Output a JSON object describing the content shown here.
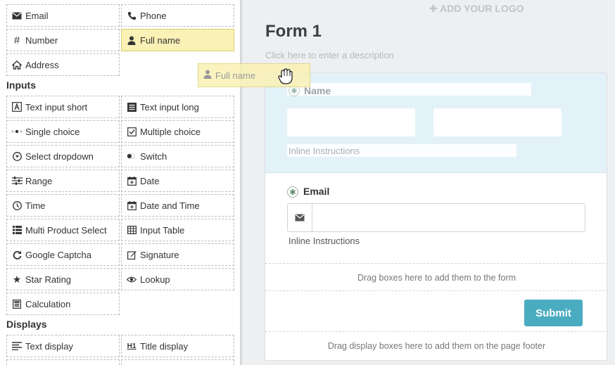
{
  "palette": {
    "submit_bg": "#4aacc0",
    "active_field_bg": "#f9f1b5",
    "selected_section_bg": "#e3f2f8",
    "canvas_bg": "#eeeff1"
  },
  "sidebar": {
    "top_fields": [
      {
        "label": "Email",
        "icon": "envelope-icon"
      },
      {
        "label": "Phone",
        "icon": "phone-icon"
      },
      {
        "label": "Number",
        "icon": "hash-icon"
      },
      {
        "label": "Full name",
        "icon": "user-icon"
      },
      {
        "label": "Address",
        "icon": "home-icon"
      }
    ],
    "inputs_heading": "Inputs",
    "inputs": [
      {
        "label": "Text input short",
        "icon": "text-a-icon"
      },
      {
        "label": "Text input long",
        "icon": "text-block-icon"
      },
      {
        "label": "Single choice",
        "icon": "radio-dots-icon"
      },
      {
        "label": "Multiple choice",
        "icon": "checkbox-icon"
      },
      {
        "label": "Select dropdown",
        "icon": "dropdown-circle-icon"
      },
      {
        "label": "Switch",
        "icon": "toggle-icon"
      },
      {
        "label": "Range",
        "icon": "sliders-icon"
      },
      {
        "label": "Date",
        "icon": "calendar-icon"
      },
      {
        "label": "Time",
        "icon": "clock-icon"
      },
      {
        "label": "Date and Time",
        "icon": "calendar-plus-icon"
      },
      {
        "label": "Multi Product Select",
        "icon": "list-icon"
      },
      {
        "label": "Input Table",
        "icon": "table-icon"
      },
      {
        "label": "Google Captcha",
        "icon": "refresh-icon"
      },
      {
        "label": "Signature",
        "icon": "edit-icon"
      },
      {
        "label": "Star Rating",
        "icon": "star-icon"
      },
      {
        "label": "Lookup",
        "icon": "eye-icon"
      },
      {
        "label": "Calculation",
        "icon": "calculator-icon"
      }
    ],
    "displays_heading": "Displays",
    "displays": [
      {
        "label": "Text display",
        "icon": "align-left-icon"
      },
      {
        "label": "Title display",
        "icon": "heading-icon"
      }
    ]
  },
  "canvas": {
    "add_logo": "ADD YOUR LOGO",
    "form_title": "Form 1",
    "form_description_placeholder": "Click here to enter a description",
    "name_field": {
      "label": "Name",
      "instructions": "Inline Instructions"
    },
    "email_field": {
      "label": "Email",
      "instructions": "Inline Instructions"
    },
    "drop_zone_text": "Drag boxes here to add them to the form",
    "submit_label": "Submit",
    "footer_drop_text": "Drag display boxes here to add them on the page footer"
  },
  "drag_ghost": {
    "label": "Full name",
    "icon": "user-icon"
  }
}
